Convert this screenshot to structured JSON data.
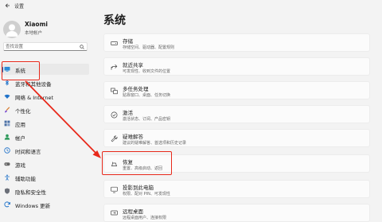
{
  "window": {
    "title": "设置"
  },
  "user": {
    "name": "Xiaomi",
    "account_type": "本地帐户"
  },
  "search": {
    "placeholder": "查找设置"
  },
  "sidebar": {
    "items": [
      {
        "label": "系统",
        "icon": "monitor-icon",
        "selected": true
      },
      {
        "label": "蓝牙和其他设备",
        "icon": "bluetooth-icon"
      },
      {
        "label": "网络 & Internet",
        "icon": "wifi-icon"
      },
      {
        "label": "个性化",
        "icon": "brush-icon"
      },
      {
        "label": "应用",
        "icon": "apps-icon"
      },
      {
        "label": "帐户",
        "icon": "person-icon"
      },
      {
        "label": "时间和语言",
        "icon": "globe-clock-icon"
      },
      {
        "label": "游戏",
        "icon": "gamepad-icon"
      },
      {
        "label": "辅助功能",
        "icon": "accessibility-icon"
      },
      {
        "label": "隐私和安全性",
        "icon": "shield-icon"
      },
      {
        "label": "Windows 更新",
        "icon": "update-icon"
      }
    ]
  },
  "main": {
    "title": "系统",
    "cards": [
      {
        "title": "存储",
        "subtitle": "存储空间、驱动器、配置规则",
        "icon": "storage-icon"
      },
      {
        "title": "就近共享",
        "subtitle": "可发现性、收到文件的位置",
        "icon": "share-icon"
      },
      {
        "title": "多任务处理",
        "subtitle": "贴靠窗口、桌面、任务切换",
        "icon": "multitask-icon"
      },
      {
        "title": "激活",
        "subtitle": "激活状态、订阅、产品密钥",
        "icon": "check-icon"
      },
      {
        "title": "疑难解答",
        "subtitle": "建议的疑难解答、首选项和历史记录",
        "icon": "wrench-icon"
      },
      {
        "title": "恢复",
        "subtitle": "重置、高级启动、返回",
        "icon": "recovery-icon"
      },
      {
        "title": "投影到此电脑",
        "subtitle": "权限、配对 PIN、可发现性",
        "icon": "projection-icon"
      },
      {
        "title": "远程桌面",
        "subtitle": "远程桌面用户、连接权限",
        "icon": "remote-desktop-icon"
      }
    ]
  },
  "colors": {
    "accent": "#0067c0",
    "annotation": "#e8291b"
  }
}
